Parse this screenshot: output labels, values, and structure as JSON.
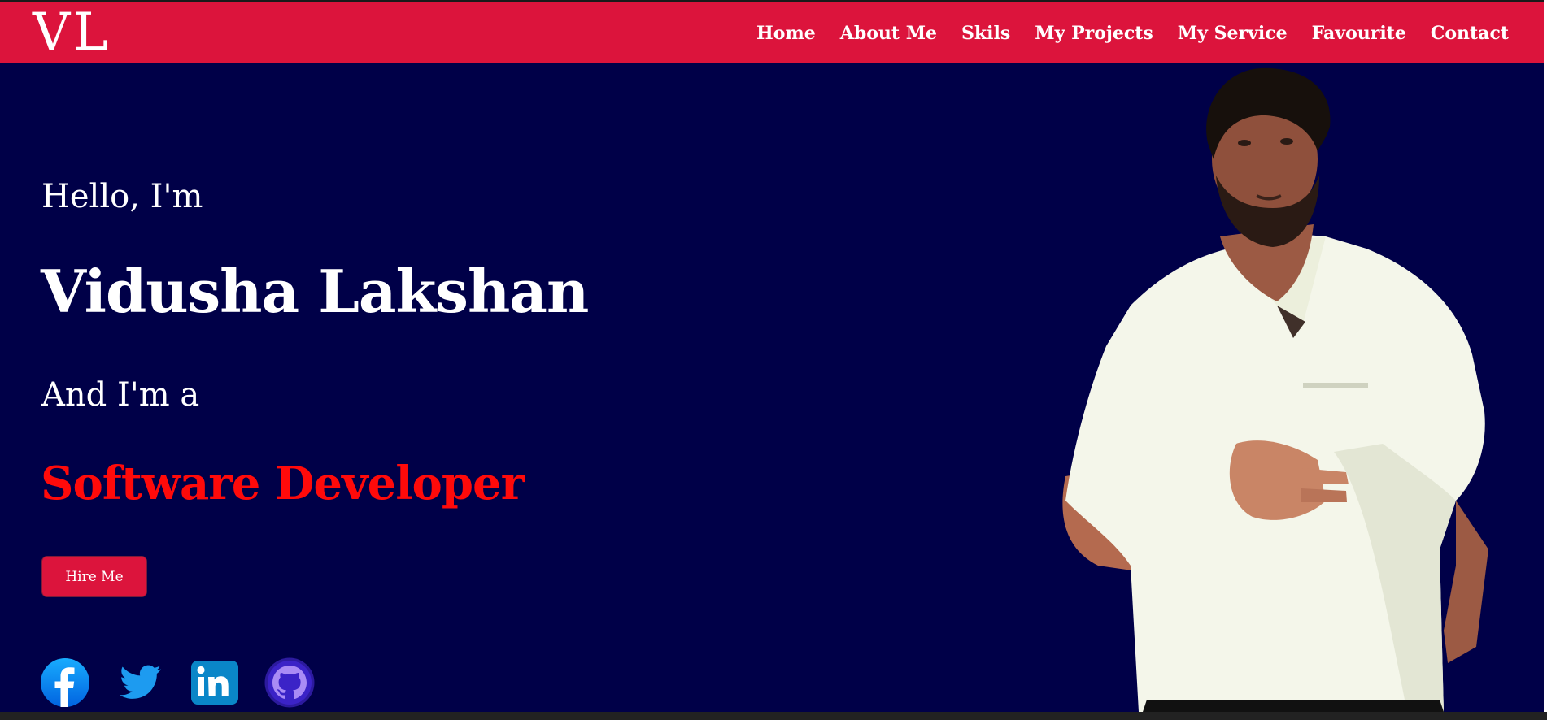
{
  "header": {
    "logo": "VL",
    "nav": [
      {
        "label": "Home"
      },
      {
        "label": "About Me"
      },
      {
        "label": "Skils"
      },
      {
        "label": "My Projects"
      },
      {
        "label": "My Service"
      },
      {
        "label": "Favourite"
      },
      {
        "label": "Contact"
      }
    ]
  },
  "hero": {
    "greeting": "Hello, I'm",
    "name": "Vidusha Lakshan",
    "intro": "And I'm a",
    "role": "Software Developer",
    "cta_label": "Hire Me"
  },
  "socials": [
    {
      "icon": "facebook-icon"
    },
    {
      "icon": "twitter-icon"
    },
    {
      "icon": "linkedin-icon"
    },
    {
      "icon": "github-icon"
    }
  ],
  "colors": {
    "background": "#000048",
    "navbar": "#dc143c",
    "role_text": "#ff0a0a",
    "button": "#dc143c"
  }
}
